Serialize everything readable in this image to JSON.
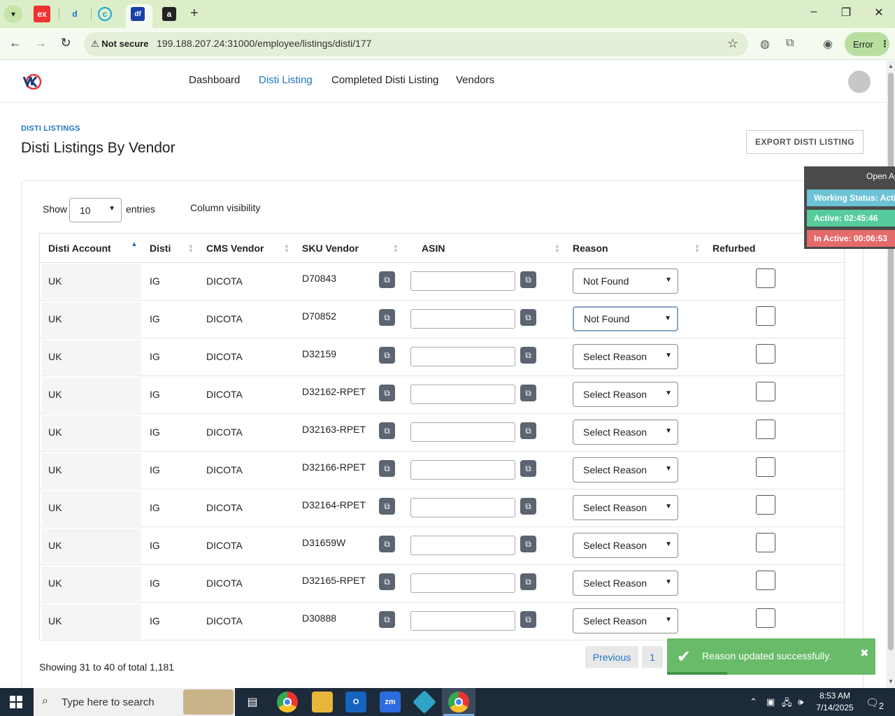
{
  "browser": {
    "tab_favicons": [
      "ex",
      "d",
      "c",
      "df",
      "a"
    ],
    "new_tab_symbol": "+",
    "not_secure_label": "Not secure",
    "url": "199.188.207.24:31000/employee/listings/disti/177",
    "profile_button_label": "Error",
    "window_controls": [
      "–",
      "❐",
      "✕"
    ]
  },
  "header": {
    "nav": [
      "Dashboard",
      "Disti Listing",
      "Completed Disti Listing",
      "Vendors"
    ],
    "active_nav_index": 1
  },
  "page": {
    "breadcrumb": "DISTI LISTINGS",
    "title": "Disti Listings By Vendor",
    "export_label": "EXPORT DISTI LISTING"
  },
  "table_controls": {
    "show_label": "Show",
    "entries_value": "10",
    "entries_label": "entries",
    "column_visibility_label": "Column visibility"
  },
  "table": {
    "columns": [
      "Disti Account",
      "Disti",
      "CMS Vendor",
      "SKU Vendor",
      "ASIN",
      "Reason",
      "Refurbed"
    ],
    "rows": [
      {
        "account": "UK",
        "disti": "IG",
        "vendor": "DICOTA",
        "sku": "D70843",
        "asin": "",
        "reason": "Not Found",
        "refurbed": false
      },
      {
        "account": "UK",
        "disti": "IG",
        "vendor": "DICOTA",
        "sku": "D70852",
        "asin": "",
        "reason": "Not Found",
        "refurbed": false
      },
      {
        "account": "UK",
        "disti": "IG",
        "vendor": "DICOTA",
        "sku": "D32159",
        "asin": "",
        "reason": "Select Reason",
        "refurbed": false
      },
      {
        "account": "UK",
        "disti": "IG",
        "vendor": "DICOTA",
        "sku": "D32162-RPET",
        "asin": "",
        "reason": "Select Reason",
        "refurbed": false
      },
      {
        "account": "UK",
        "disti": "IG",
        "vendor": "DICOTA",
        "sku": "D32163-RPET",
        "asin": "",
        "reason": "Select Reason",
        "refurbed": false
      },
      {
        "account": "UK",
        "disti": "IG",
        "vendor": "DICOTA",
        "sku": "D32166-RPET",
        "asin": "",
        "reason": "Select Reason",
        "refurbed": false
      },
      {
        "account": "UK",
        "disti": "IG",
        "vendor": "DICOTA",
        "sku": "D32164-RPET",
        "asin": "",
        "reason": "Select Reason",
        "refurbed": false
      },
      {
        "account": "UK",
        "disti": "IG",
        "vendor": "DICOTA",
        "sku": "D31659W",
        "asin": "",
        "reason": "Select Reason",
        "refurbed": false
      },
      {
        "account": "UK",
        "disti": "IG",
        "vendor": "DICOTA",
        "sku": "D32165-RPET",
        "asin": "",
        "reason": "Select Reason",
        "refurbed": false
      },
      {
        "account": "UK",
        "disti": "IG",
        "vendor": "DICOTA",
        "sku": "D30888",
        "asin": "",
        "reason": "Select Reason",
        "refurbed": false
      }
    ]
  },
  "pagination": {
    "summary": "Showing 31 to 40 of total 1,181",
    "previous_label": "Previous",
    "current_page": "1"
  },
  "status_widget": {
    "open_label": "Open Ap",
    "working_status": "Working Status: Active",
    "active": "Active: 02:45:46",
    "inactive": "In Active: 00:06:53",
    "colors": {
      "working": "#6cc3d5",
      "active": "#56cc9d",
      "inactive": "#e56a6a"
    }
  },
  "toast": {
    "message": "Reason updated successfully.",
    "close_symbol": "✖"
  },
  "taskbar": {
    "search_placeholder": "Type here to search",
    "apps": [
      "task-view",
      "chrome",
      "file-explorer",
      "outlook",
      "zoom",
      "app",
      "chrome-profile"
    ],
    "zoom_label": "zm",
    "time": "8:53 AM",
    "date": "7/14/2025",
    "notification_count": "2"
  }
}
